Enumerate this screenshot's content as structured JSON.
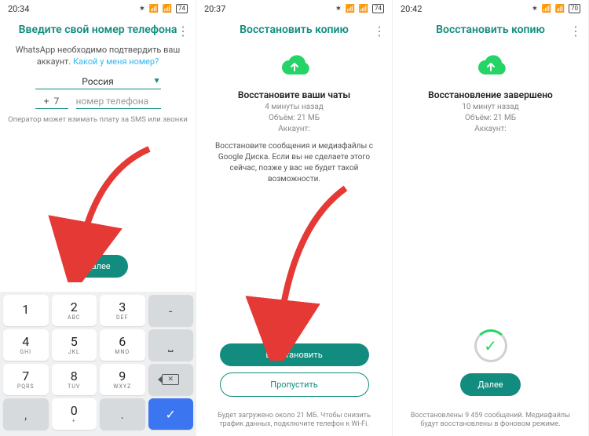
{
  "accent": "#128C7E",
  "screen1": {
    "status": {
      "time": "20:34",
      "battery": "74"
    },
    "title": "Введите свой номер телефона",
    "subtitle_prefix": "WhatsApp необходимо подтвердить ваш аккаунт. ",
    "subtitle_link": "Какой у меня номер?",
    "country": "Россия",
    "cc_plus": "+",
    "cc_code": "7",
    "phone_placeholder": "номер телефона",
    "carrier_note": "Оператор может взимать плату за SMS или звонки",
    "next_label": "Далее",
    "keypad": {
      "r1": [
        {
          "n": "1",
          "l": ""
        },
        {
          "n": "2",
          "l": "ABC"
        },
        {
          "n": "3",
          "l": "DEF"
        },
        {
          "sym": "-"
        }
      ],
      "r2": [
        {
          "n": "4",
          "l": "GHI"
        },
        {
          "n": "5",
          "l": "JKL"
        },
        {
          "n": "6",
          "l": "MNO"
        },
        {
          "sym": "␣"
        }
      ],
      "r3": [
        {
          "n": "7",
          "l": "PQRS"
        },
        {
          "n": "8",
          "l": "TUV"
        },
        {
          "n": "9",
          "l": "WXYZ"
        },
        {
          "sym": "⌫"
        }
      ],
      "r4": [
        {
          "sym": ","
        },
        {
          "n": "0",
          "l": "+"
        },
        {
          "sym": "."
        },
        {
          "sym": "✓"
        }
      ]
    }
  },
  "screen2": {
    "status": {
      "time": "20:37",
      "battery": "74"
    },
    "title": "Восстановить копию",
    "section_title": "Восстановите ваши чаты",
    "time_ago": "4 минуты назад",
    "size_line": "Объём: 21 МБ",
    "account_label": "Аккаунт:",
    "body": "Восстановите сообщения и медиафайлы с Google Диска. Если вы не сделаете этого сейчас, позже у вас не будет такой возможности.",
    "restore_label": "Восстановить",
    "skip_label": "Пропустить",
    "footer": "Будет загружено около 21 МБ. Чтобы снизить трафик данных, подключите телефон к Wi-Fi."
  },
  "screen3": {
    "status": {
      "time": "20:42",
      "battery": "70"
    },
    "title": "Восстановить копию",
    "section_title": "Восстановление завершено",
    "time_ago": "10 минут назад",
    "size_line": "Объём: 21 МБ",
    "account_label": "Аккаунт:",
    "next_label": "Далее",
    "footer": "Восстановлены 9 459 сообщений. Медиафайлы будут восстановлены в фоновом режиме."
  }
}
